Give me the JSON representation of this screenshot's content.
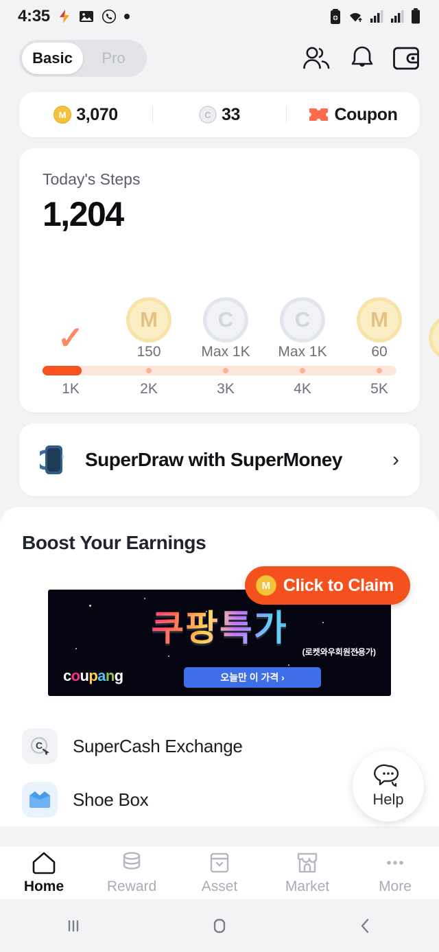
{
  "status_bar": {
    "time": "4:35",
    "icons": [
      "app-badge-icon",
      "gallery-icon",
      "viber-icon",
      "dot-indicator",
      "battery-saver-icon",
      "wifi-icon",
      "signal-1-icon",
      "signal-2-icon",
      "battery-icon"
    ]
  },
  "header": {
    "segmented": {
      "options": [
        "Basic",
        "Pro"
      ],
      "selected": "Basic"
    },
    "icons": [
      "friends-icon",
      "notification-bell-icon",
      "wallet-icon"
    ]
  },
  "balance": {
    "items": [
      {
        "icon": "m-coin-icon",
        "value": "3,070"
      },
      {
        "icon": "c-coin-icon",
        "value": "33"
      },
      {
        "icon": "coupon-ticket-icon",
        "value": "Coupon"
      }
    ]
  },
  "steps_card": {
    "label": "Today's Steps",
    "value": "1,204",
    "milestones": [
      {
        "tick": "1K",
        "type": "check",
        "label": ""
      },
      {
        "tick": "2K",
        "type": "gold",
        "symbol": "M",
        "label": "150"
      },
      {
        "tick": "3K",
        "type": "silver",
        "symbol": "C",
        "label": "Max 1K"
      },
      {
        "tick": "4K",
        "type": "silver",
        "symbol": "C",
        "label": "Max 1K"
      },
      {
        "tick": "5K",
        "type": "gold",
        "symbol": "M",
        "label": "60"
      },
      {
        "tick": "",
        "type": "gold",
        "symbol": "",
        "label": ""
      }
    ],
    "progress_percent": 13
  },
  "superdraw": {
    "title": "SuperDraw with SuperMoney",
    "icon": "smartwatch-icon",
    "chevron": "›"
  },
  "boost": {
    "title": "Boost Your Earnings",
    "ad": {
      "headline": "쿠팡특가",
      "subline": "(로켓와우회원전용가)",
      "brand": "coupang",
      "cta": "오늘만 이 가격 ›"
    },
    "claim_button": {
      "label": "Click to Claim",
      "icon": "m-coin-icon"
    }
  },
  "list": [
    {
      "icon": "supercash-exchange-icon",
      "title": "SuperCash Exchange"
    },
    {
      "icon": "shoe-box-icon",
      "title": "Shoe Box"
    }
  ],
  "help_fab": {
    "label": "Help",
    "icon": "chat-bubble-icon"
  },
  "tabbar": {
    "items": [
      {
        "label": "Home",
        "icon": "home-icon",
        "active": true
      },
      {
        "label": "Reward",
        "icon": "coins-icon",
        "active": false
      },
      {
        "label": "Asset",
        "icon": "box-icon",
        "active": false
      },
      {
        "label": "Market",
        "icon": "store-icon",
        "active": false
      },
      {
        "label": "More",
        "icon": "ellipsis-icon",
        "active": false
      }
    ]
  },
  "android_nav": {
    "recents": "|||",
    "home": "▢",
    "back": "‹"
  },
  "colors": {
    "accent": "#f7511e",
    "claim": "#f4511e",
    "gold": "#f5c33b",
    "track": "#fde6dc"
  }
}
